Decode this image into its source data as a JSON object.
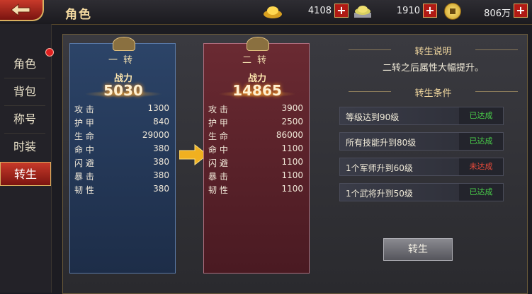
{
  "header": {
    "title": "角色",
    "resources": [
      {
        "icon": "gold-ingot-icon",
        "value": "4108"
      },
      {
        "icon": "silver-ingot-icon",
        "value": "1910"
      },
      {
        "icon": "copper-coin-icon",
        "value": "806万"
      }
    ],
    "plus_label": "+"
  },
  "sidebar": {
    "items": [
      {
        "label": "角色"
      },
      {
        "label": "背包"
      },
      {
        "label": "称号"
      },
      {
        "label": "时装"
      },
      {
        "label": "转生"
      }
    ],
    "active_index": 4
  },
  "panels": {
    "first": {
      "title": "一转",
      "power_label": "战力",
      "power_value": "5030",
      "stats": [
        {
          "k": "攻  击",
          "v": "1300"
        },
        {
          "k": "护  甲",
          "v": "840"
        },
        {
          "k": "生  命",
          "v": "29000"
        },
        {
          "k": "命  中",
          "v": "380"
        },
        {
          "k": "闪  避",
          "v": "380"
        },
        {
          "k": "暴  击",
          "v": "380"
        },
        {
          "k": "韧  性",
          "v": "380"
        }
      ]
    },
    "second": {
      "title": "二转",
      "power_label": "战力",
      "power_value": "14865",
      "stats": [
        {
          "k": "攻  击",
          "v": "3900"
        },
        {
          "k": "护  甲",
          "v": "2500"
        },
        {
          "k": "生  命",
          "v": "86000"
        },
        {
          "k": "命  中",
          "v": "1100"
        },
        {
          "k": "闪  避",
          "v": "1100"
        },
        {
          "k": "暴  击",
          "v": "1100"
        },
        {
          "k": "韧  性",
          "v": "1100"
        }
      ]
    }
  },
  "info": {
    "explain_title": "转生说明",
    "explain_text": "二转之后属性大幅提升。",
    "conditions_title": "转生条件",
    "conditions": [
      {
        "text": "等级达到90级",
        "status": "已达成",
        "ok": true
      },
      {
        "text": "所有技能升到80级",
        "status": "已达成",
        "ok": true
      },
      {
        "text": "1个军师升到60级",
        "status": "未达成",
        "ok": false
      },
      {
        "text": "1个武将升到50级",
        "status": "已达成",
        "ok": true
      }
    ],
    "button_label": "转生"
  },
  "colors": {
    "accent_red": "#c83a2a",
    "gold_text": "#f3d9a0",
    "status_ok": "#4ad04a",
    "status_fail": "#e84a3a"
  }
}
